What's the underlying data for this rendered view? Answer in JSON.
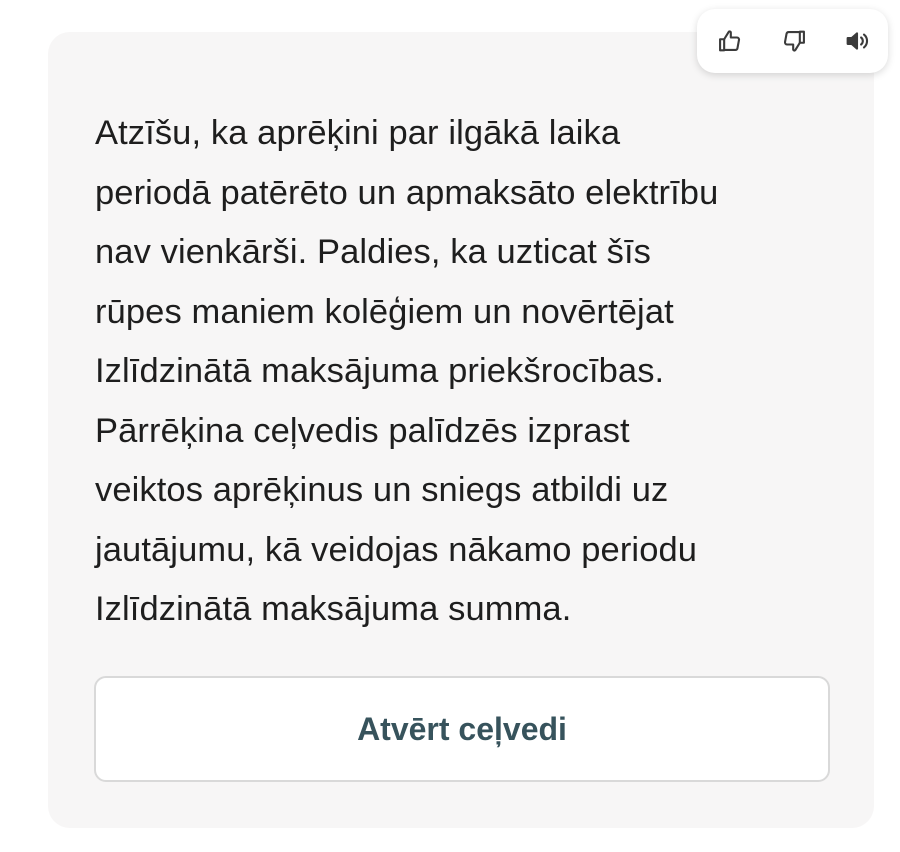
{
  "feedback": {
    "icons": [
      "thumbs-up-icon",
      "thumbs-down-icon",
      "speaker-icon"
    ]
  },
  "message": {
    "lines": [
      "Atzīšu, ka aprēķini par ilgākā laika",
      "periodā patērēto un apmaksāto elektrību",
      "nav vienkārši. Paldies, ka uzticat šīs",
      "rūpes maniem kolēģiem un novērtējat",
      "Izlīdzinātā maksājuma priekšrocības.",
      "Pārrēķina ceļvedis palīdzēs izprast",
      "veiktos aprēķinus un sniegs atbildi uz",
      "jautājumu, kā veidojas nākamo periodu",
      "Izlīdzinātā maksājuma summa."
    ]
  },
  "action": {
    "button_label": "Atvērt ceļvedi"
  },
  "colors": {
    "card_background": "#f7f6f6",
    "text": "#1e1e1e",
    "button_text": "#37535c",
    "button_border": "#d9d9d9"
  }
}
